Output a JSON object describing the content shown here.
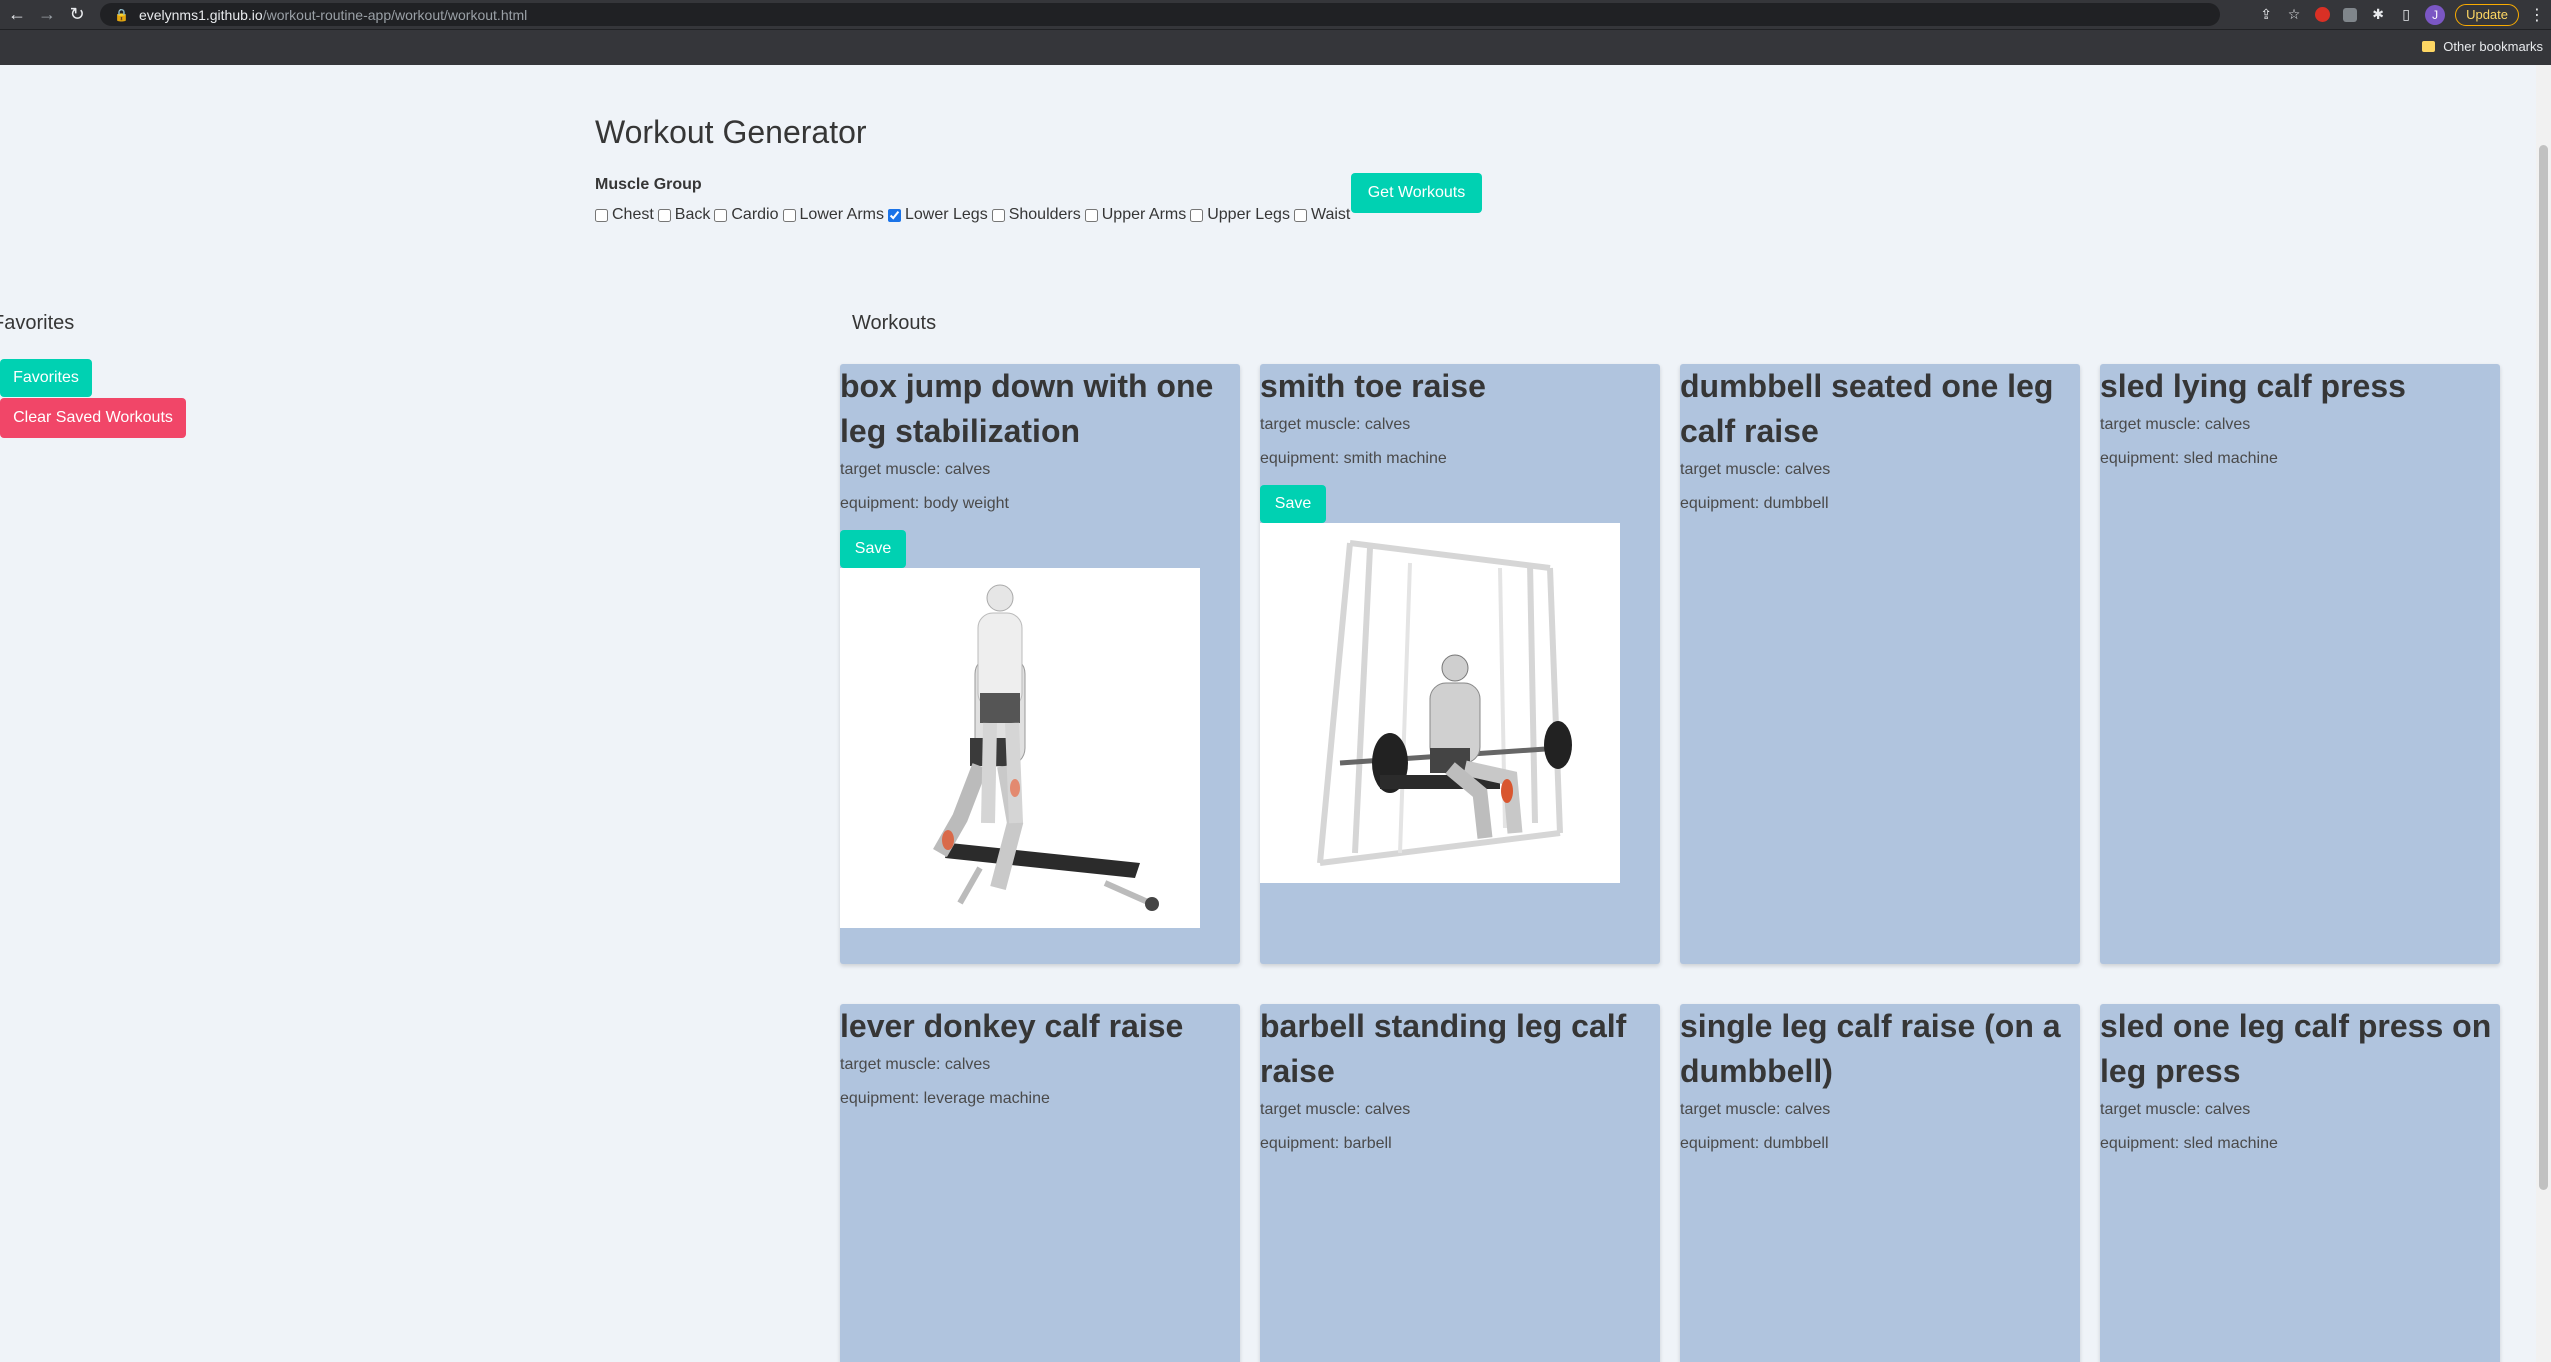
{
  "browser": {
    "url_host": "evelynms1.github.io",
    "url_path": "/workout-routine-app/workout/workout.html",
    "update_label": "Update",
    "avatar_letter": "J",
    "other_bookmarks": "Other bookmarks"
  },
  "page": {
    "title": "Workout Generator",
    "muscle_group_label": "Muscle Group",
    "get_workouts_label": "Get Workouts",
    "muscle_groups": [
      {
        "label": "Chest",
        "checked": false
      },
      {
        "label": "Back",
        "checked": false
      },
      {
        "label": "Cardio",
        "checked": false
      },
      {
        "label": "Lower Arms",
        "checked": false
      },
      {
        "label": "Lower Legs",
        "checked": true
      },
      {
        "label": "Shoulders",
        "checked": false
      },
      {
        "label": "Upper Arms",
        "checked": false
      },
      {
        "label": "Upper Legs",
        "checked": false
      },
      {
        "label": "Waist",
        "checked": false
      }
    ]
  },
  "favorites": {
    "heading": "Favorites",
    "favorites_button": "Favorites",
    "clear_button": "Clear Saved Workouts"
  },
  "workouts": {
    "heading": "Workouts",
    "save_label": "Save",
    "cards": [
      {
        "title": "box jump down with one leg stabilization",
        "target": "target muscle: calves",
        "equipment": "equipment: body weight",
        "has_save": true,
        "image": "jump-down-illustration"
      },
      {
        "title": "smith toe raise",
        "target": "target muscle: calves",
        "equipment": "equipment: smith machine",
        "has_save": true,
        "image": "smith-machine-illustration"
      },
      {
        "title": "dumbbell seated one leg calf raise",
        "target": "target muscle: calves",
        "equipment": "equipment: dumbbell",
        "has_save": false
      },
      {
        "title": "sled lying calf press",
        "target": "target muscle: calves",
        "equipment": "equipment: sled machine",
        "has_save": false
      },
      {
        "title": "lever donkey calf raise",
        "target": "target muscle: calves",
        "equipment": "equipment: leverage machine",
        "has_save": false
      },
      {
        "title": "barbell standing leg calf raise",
        "target": "target muscle: calves",
        "equipment": "equipment: barbell",
        "has_save": false
      },
      {
        "title": "single leg calf raise (on a dumbbell)",
        "target": "target muscle: calves",
        "equipment": "equipment: dumbbell",
        "has_save": false
      },
      {
        "title": "sled one leg calf press on leg press",
        "target": "target muscle: calves",
        "equipment": "equipment: sled machine",
        "has_save": false
      }
    ]
  },
  "colors": {
    "primary": "#00d1b2",
    "danger": "#f14668",
    "card_bg": "#b0c4de",
    "page_bg": "#eff3f8"
  }
}
